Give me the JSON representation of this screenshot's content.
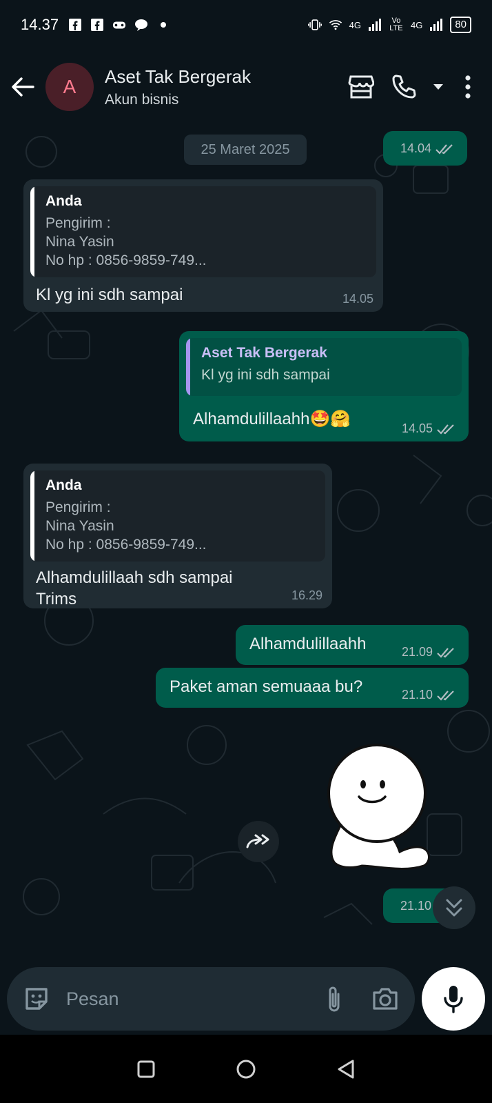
{
  "status_bar": {
    "time": "14.37",
    "network_1": "4G",
    "network_2": "4G",
    "volte": "Vo LTE",
    "battery": "80"
  },
  "header": {
    "avatar_letter": "A",
    "contact_name": "Aset Tak Bergerak",
    "subtitle": "Akun bisnis"
  },
  "chat": {
    "top_time": "14.04",
    "date_chip": "25 Maret 2025",
    "messages": [
      {
        "dir": "in",
        "quote_author": "Anda",
        "quote_lines": [
          "Pengirim :",
          "Nina Yasin",
          "No hp : 0856-9859-749..."
        ],
        "text": "Kl yg ini sdh sampai",
        "time": "14.05"
      },
      {
        "dir": "out",
        "quote_author": "Aset Tak Bergerak",
        "quote_lines": [
          "Kl yg ini sdh sampai"
        ],
        "text": "Alhamdulillaahh🤩🤗",
        "time": "14.05"
      },
      {
        "dir": "in",
        "quote_author": "Anda",
        "quote_lines": [
          "Pengirim :",
          "Nina Yasin",
          "No hp : 0856-9859-749..."
        ],
        "text_lines": [
          "Alhamdulillaah sdh sampai",
          "Trims"
        ],
        "time": "16.29"
      },
      {
        "dir": "out",
        "text": "Alhamdulillaahh",
        "time": "21.09"
      },
      {
        "dir": "out",
        "text": "Paket aman semuaaa bu?",
        "time": "21.10"
      },
      {
        "dir": "out",
        "type": "sticker",
        "time": "21.10"
      }
    ]
  },
  "composer": {
    "placeholder": "Pesan"
  },
  "colors": {
    "bg": "#0b141a",
    "incoming": "#202c33",
    "outgoing": "#005c4b",
    "avatar_bg": "#4a1f28",
    "accent_quote": "#a696f0"
  },
  "icons": [
    "facebook-icon",
    "facebook-icon",
    "game-icon",
    "chat-bubble-icon",
    "vibrate-icon",
    "wifi-icon",
    "signal-icon",
    "back-arrow-icon",
    "shop-icon",
    "phone-icon",
    "dropdown-icon",
    "more-icon",
    "forward-icon",
    "scroll-down-icon",
    "sticker-icon",
    "attach-icon",
    "camera-icon",
    "mic-icon"
  ]
}
